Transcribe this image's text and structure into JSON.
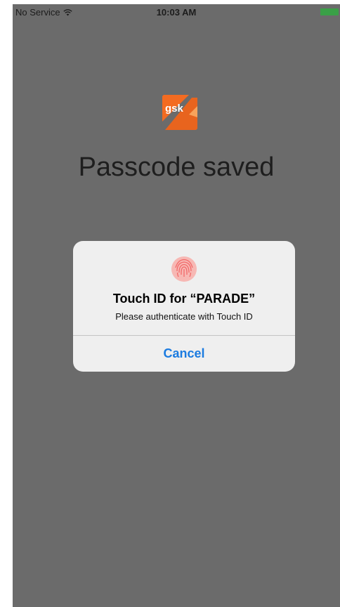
{
  "status_bar": {
    "carrier": "No Service",
    "time": "10:03 AM",
    "icons": [
      "wifi-icon",
      "battery-icon"
    ],
    "battery_color": "#3aa047"
  },
  "app": {
    "logo_text": "gsk",
    "logo_colors": [
      "#f36b21",
      "#e05a1c",
      "#f8a35b"
    ]
  },
  "main": {
    "title": "Passcode saved"
  },
  "alert": {
    "title": "Touch ID for “PARADE”",
    "message": "Please authenticate with Touch ID",
    "cancel_label": "Cancel",
    "icon": "fingerprint-icon",
    "accent_color": "#1b7be0",
    "fingerprint_color": "#f26a6a"
  },
  "background_color": "#6b6b6b"
}
